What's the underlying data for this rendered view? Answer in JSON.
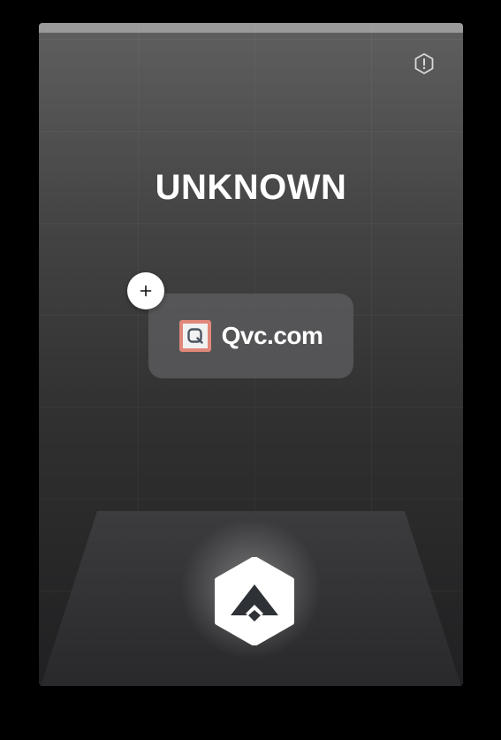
{
  "card": {
    "title": "UNKNOWN",
    "site": {
      "name": "Qvc.com",
      "favicon_letter": "Q",
      "favicon_color": "#e1887a"
    },
    "add_button_symbol": "+",
    "alert_button_icon": "alert-hexagon-icon",
    "logo_icon": "brand-hexagon-logo"
  },
  "colors": {
    "background": "#000000",
    "top_bar": "#9a9a9a",
    "text": "#ffffff",
    "logo_mark": "#2e3136"
  }
}
